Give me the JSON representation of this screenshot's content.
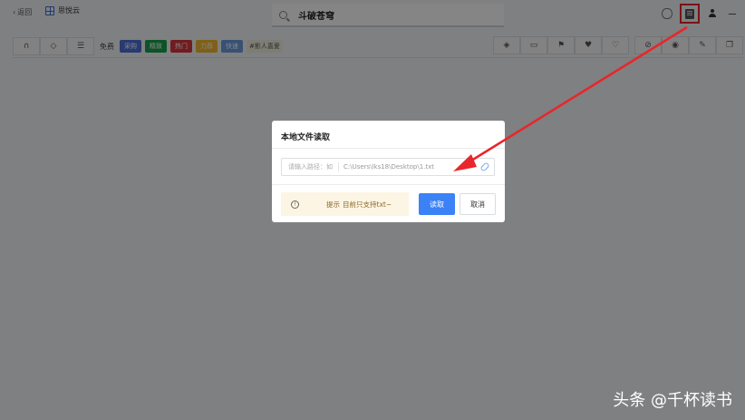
{
  "topbar": {
    "back_label": "返回",
    "app_name": "思悦云",
    "search_value": "斗破苍穹"
  },
  "toolbar": {
    "free_label": "免费",
    "tags": [
      {
        "label": "采购",
        "color": "#4e6fd6"
      },
      {
        "label": "精致",
        "color": "#19a04b"
      },
      {
        "label": "热门",
        "color": "#d9363e"
      },
      {
        "label": "力荐",
        "color": "#f3b92e"
      },
      {
        "label": "快速",
        "color": "#6b9bdd"
      }
    ],
    "hashtag": "#影人喜爱"
  },
  "modal": {
    "title": "本地文件读取",
    "path_label": "请输入路径：如",
    "path_value": "C:\\Users\\lks18\\Desktop\\1.txt",
    "tip_label": "提示",
    "tip_text": "目前只支持txt~",
    "read_button": "读取",
    "cancel_button": "取消"
  },
  "watermark": "头条 @千杯读书",
  "colors": {
    "primary": "#3b82f6",
    "highlight": "#e8262b",
    "tip_bg": "#fdf5e4"
  }
}
